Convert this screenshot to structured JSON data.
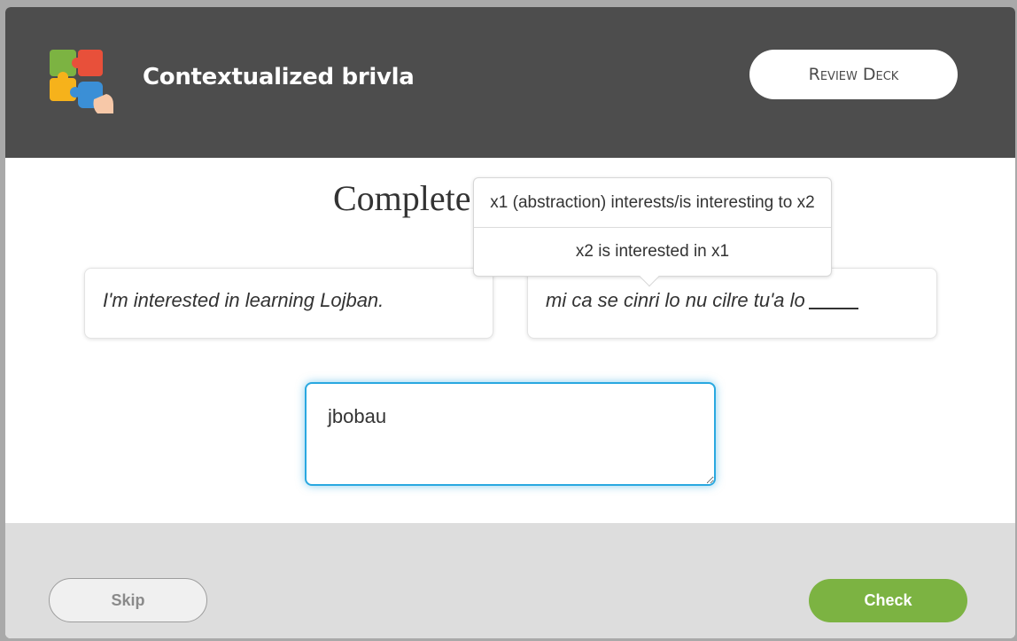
{
  "header": {
    "deck_title": "Contextualized brivla",
    "review_deck_label": "Review Deck",
    "logo_icon": "puzzle-pieces-icon"
  },
  "main": {
    "prompt_title": "Complete",
    "source_sentence": "I'm interested in learning Lojban.",
    "target_sentence": "mi ca se cinri lo nu cilre tu'a lo",
    "tooltip": {
      "lines": [
        "x1 (abstraction) interests/is interesting to x2",
        "x2 is interested in x1"
      ]
    },
    "answer": {
      "value": "jbobau",
      "focus_color": "#29a8e0"
    }
  },
  "footer": {
    "skip_label": "Skip",
    "check_label": "Check",
    "check_color": "#7cb342"
  }
}
